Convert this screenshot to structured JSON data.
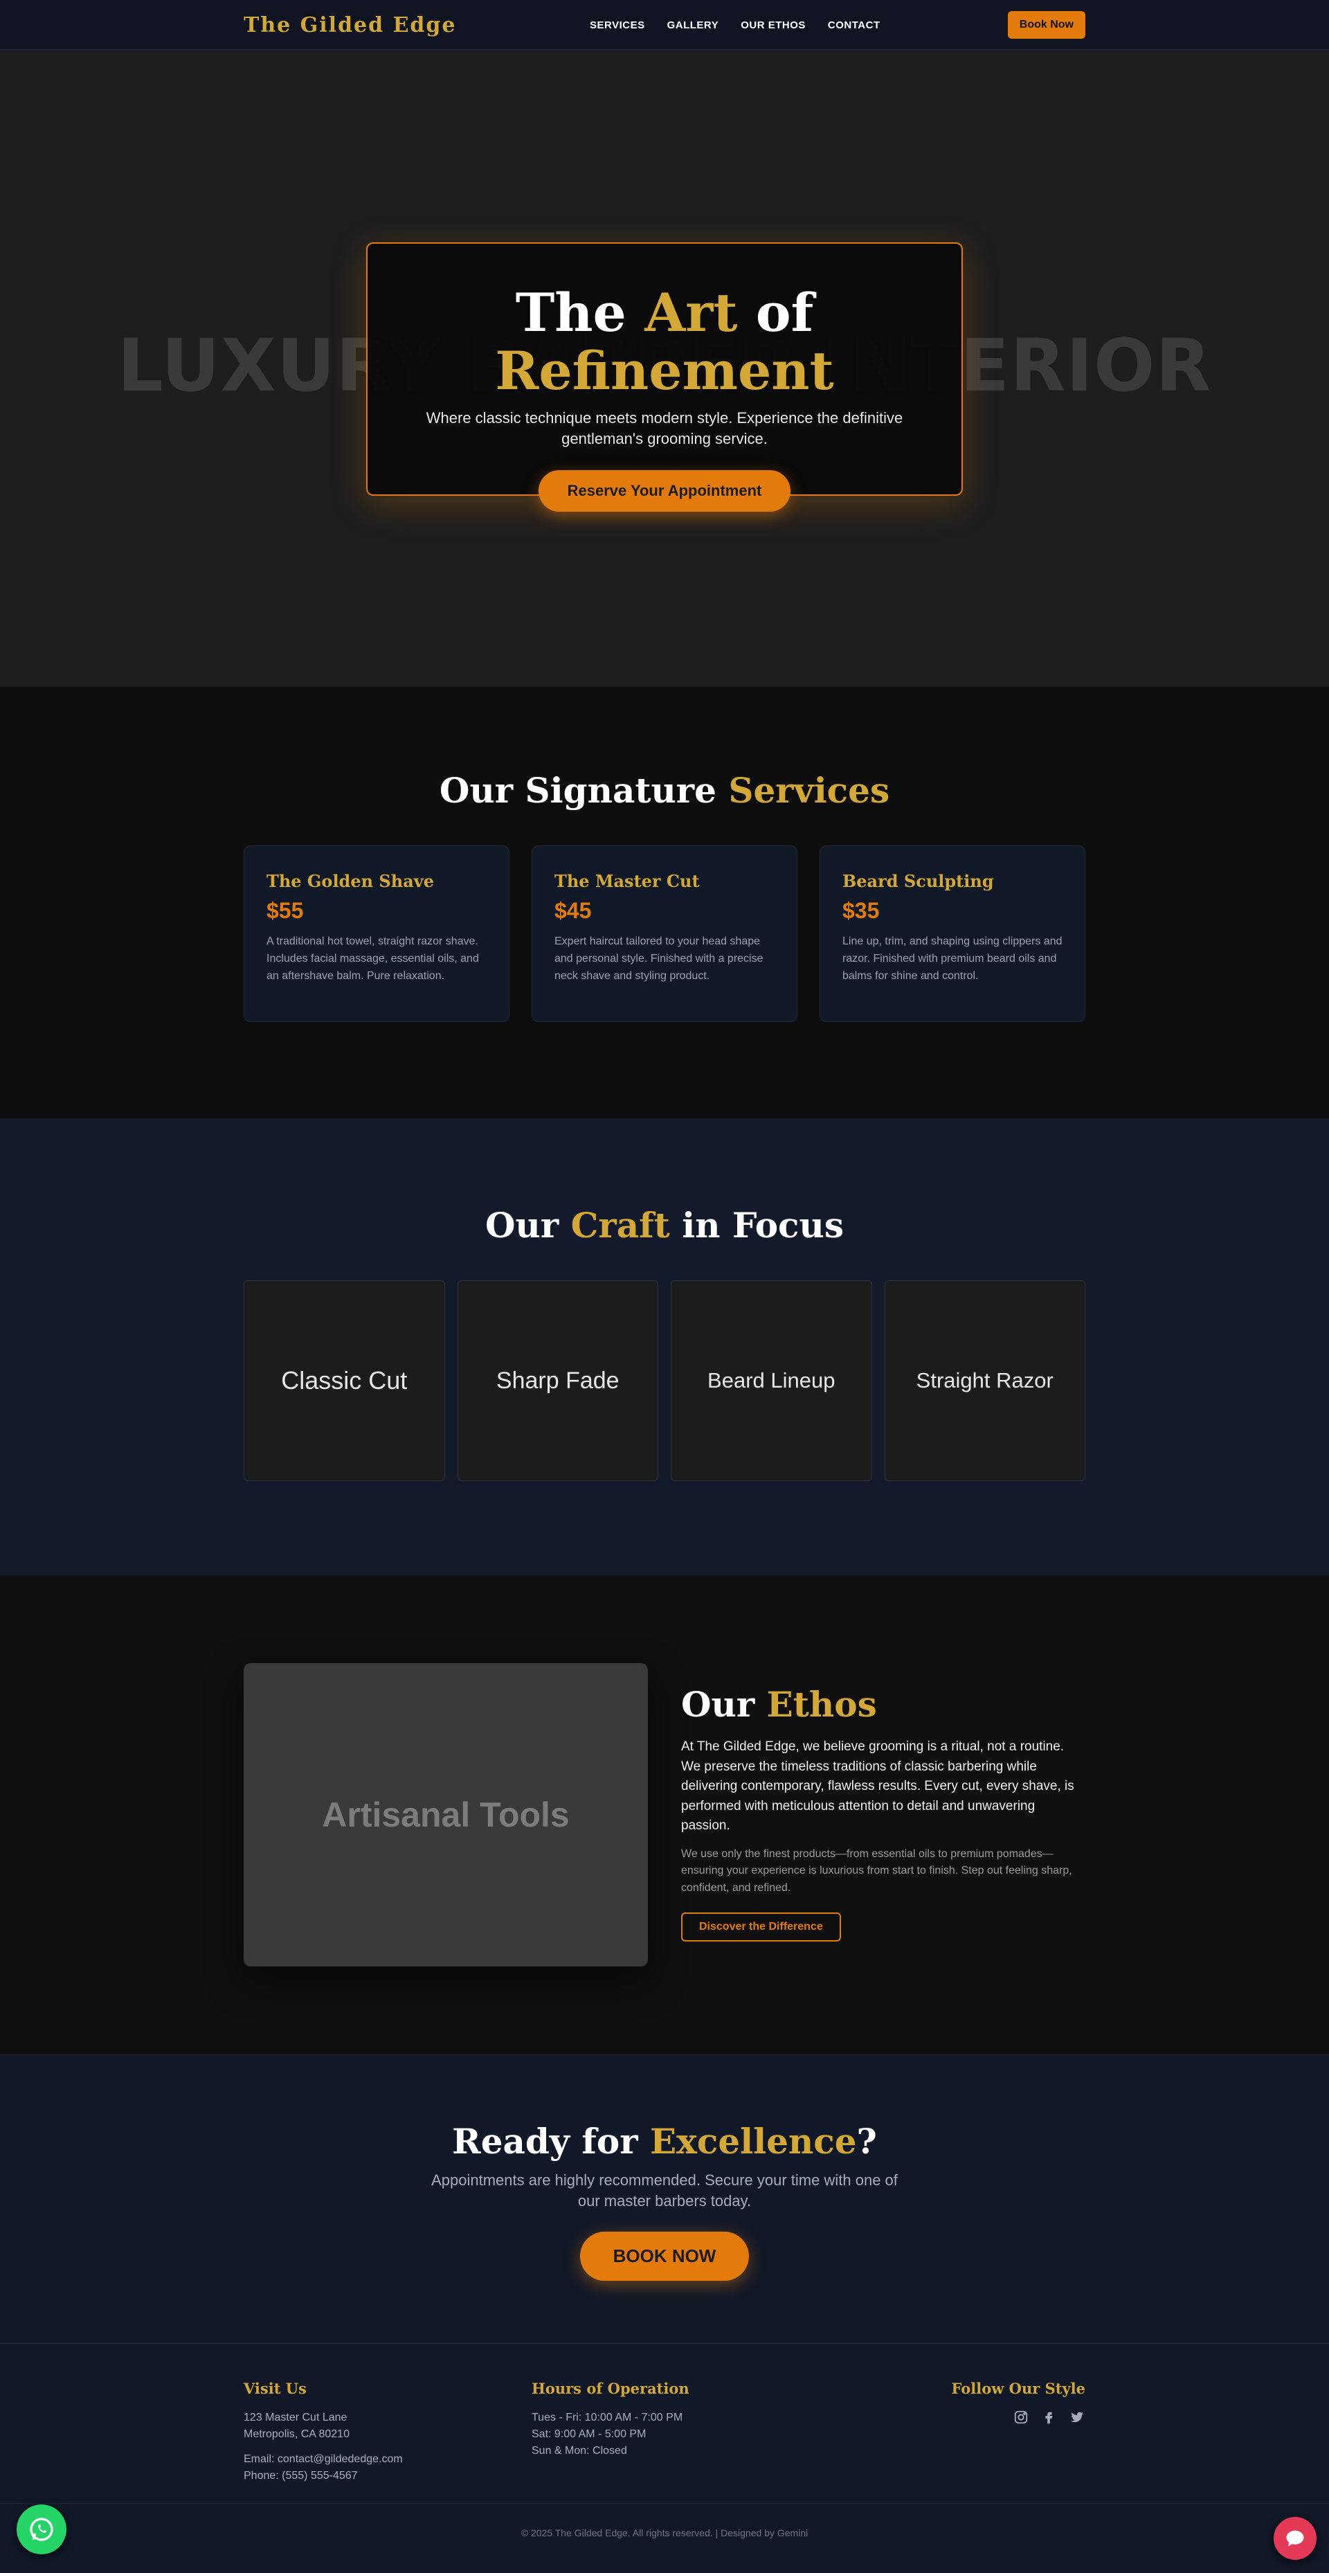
{
  "header": {
    "logo": "The Gilded Edge",
    "nav": [
      "SERVICES",
      "GALLERY",
      "OUR ETHOS",
      "CONTACT"
    ],
    "book_label": "Book Now"
  },
  "hero": {
    "bg_text": "LUXURY BARBER INTERIOR",
    "title_part1": "The ",
    "title_part2": "Art",
    "title_part3": " of ",
    "title_part4": "Refinement",
    "subtitle": "Where classic technique meets modern style. Experience the definitive gentleman's grooming service.",
    "cta_label": "Reserve Your Appointment"
  },
  "services": {
    "title_part1": "Our Signature ",
    "title_part2": "Services",
    "items": [
      {
        "name": "The Golden Shave",
        "price": "$55",
        "desc": "A traditional hot towel, straight razor shave. Includes facial massage, essential oils, and an aftershave balm. Pure relaxation."
      },
      {
        "name": "The Master Cut",
        "price": "$45",
        "desc": "Expert haircut tailored to your head shape and personal style. Finished with a precise neck shave and styling product."
      },
      {
        "name": "Beard Sculpting",
        "price": "$35",
        "desc": "Line up, trim, and shaping using clippers and razor. Finished with premium beard oils and balms for shine and control."
      }
    ]
  },
  "craft": {
    "title_part1": "Our ",
    "title_part2": "Craft",
    "title_part3": " in Focus",
    "tiles": [
      "Classic Cut",
      "Sharp Fade",
      "Beard Lineup",
      "Straight Razor"
    ]
  },
  "ethos": {
    "image_label": "Artisanal Tools",
    "title_part1": "Our ",
    "title_part2": "Ethos",
    "p1": "At The Gilded Edge, we believe grooming is a ritual, not a routine. We preserve the timeless traditions of classic barbering while delivering contemporary, flawless results. Every cut, every shave, is performed with meticulous attention to detail and unwavering passion.",
    "p2": "We use only the finest products—from essential oils to premium pomades—ensuring your experience is luxurious from start to finish. Step out feeling sharp, confident, and refined.",
    "button_label": "Discover the Difference"
  },
  "cta": {
    "title_part1": "Ready for ",
    "title_part2": "Excellence",
    "title_part3": "?",
    "subtitle": "Appointments are highly recommended. Secure your time with one of our master barbers today.",
    "button_label": "BOOK NOW"
  },
  "footer": {
    "visit_heading": "Visit Us",
    "address1": "123 Master Cut Lane",
    "address2": "Metropolis, CA 80210",
    "email": "Email: contact@gildededge.com",
    "phone": "Phone: (555) 555-4567",
    "hours_heading": "Hours of Operation",
    "hours": [
      "Tues - Fri: 10:00 AM - 7:00 PM",
      "Sat: 9:00 AM - 5:00 PM",
      "Sun & Mon: Closed"
    ],
    "follow_heading": "Follow Our Style",
    "social_icons": [
      "instagram-icon",
      "facebook-icon",
      "twitter-icon"
    ],
    "copyright": "© 2025 The Gilded Edge. All rights reserved. | Designed by Gemini"
  },
  "colors": {
    "gold": "#d4a836",
    "orange": "#e27b0c",
    "navy": "#111827",
    "whatsapp": "#25d366",
    "chat": "#e53958"
  }
}
